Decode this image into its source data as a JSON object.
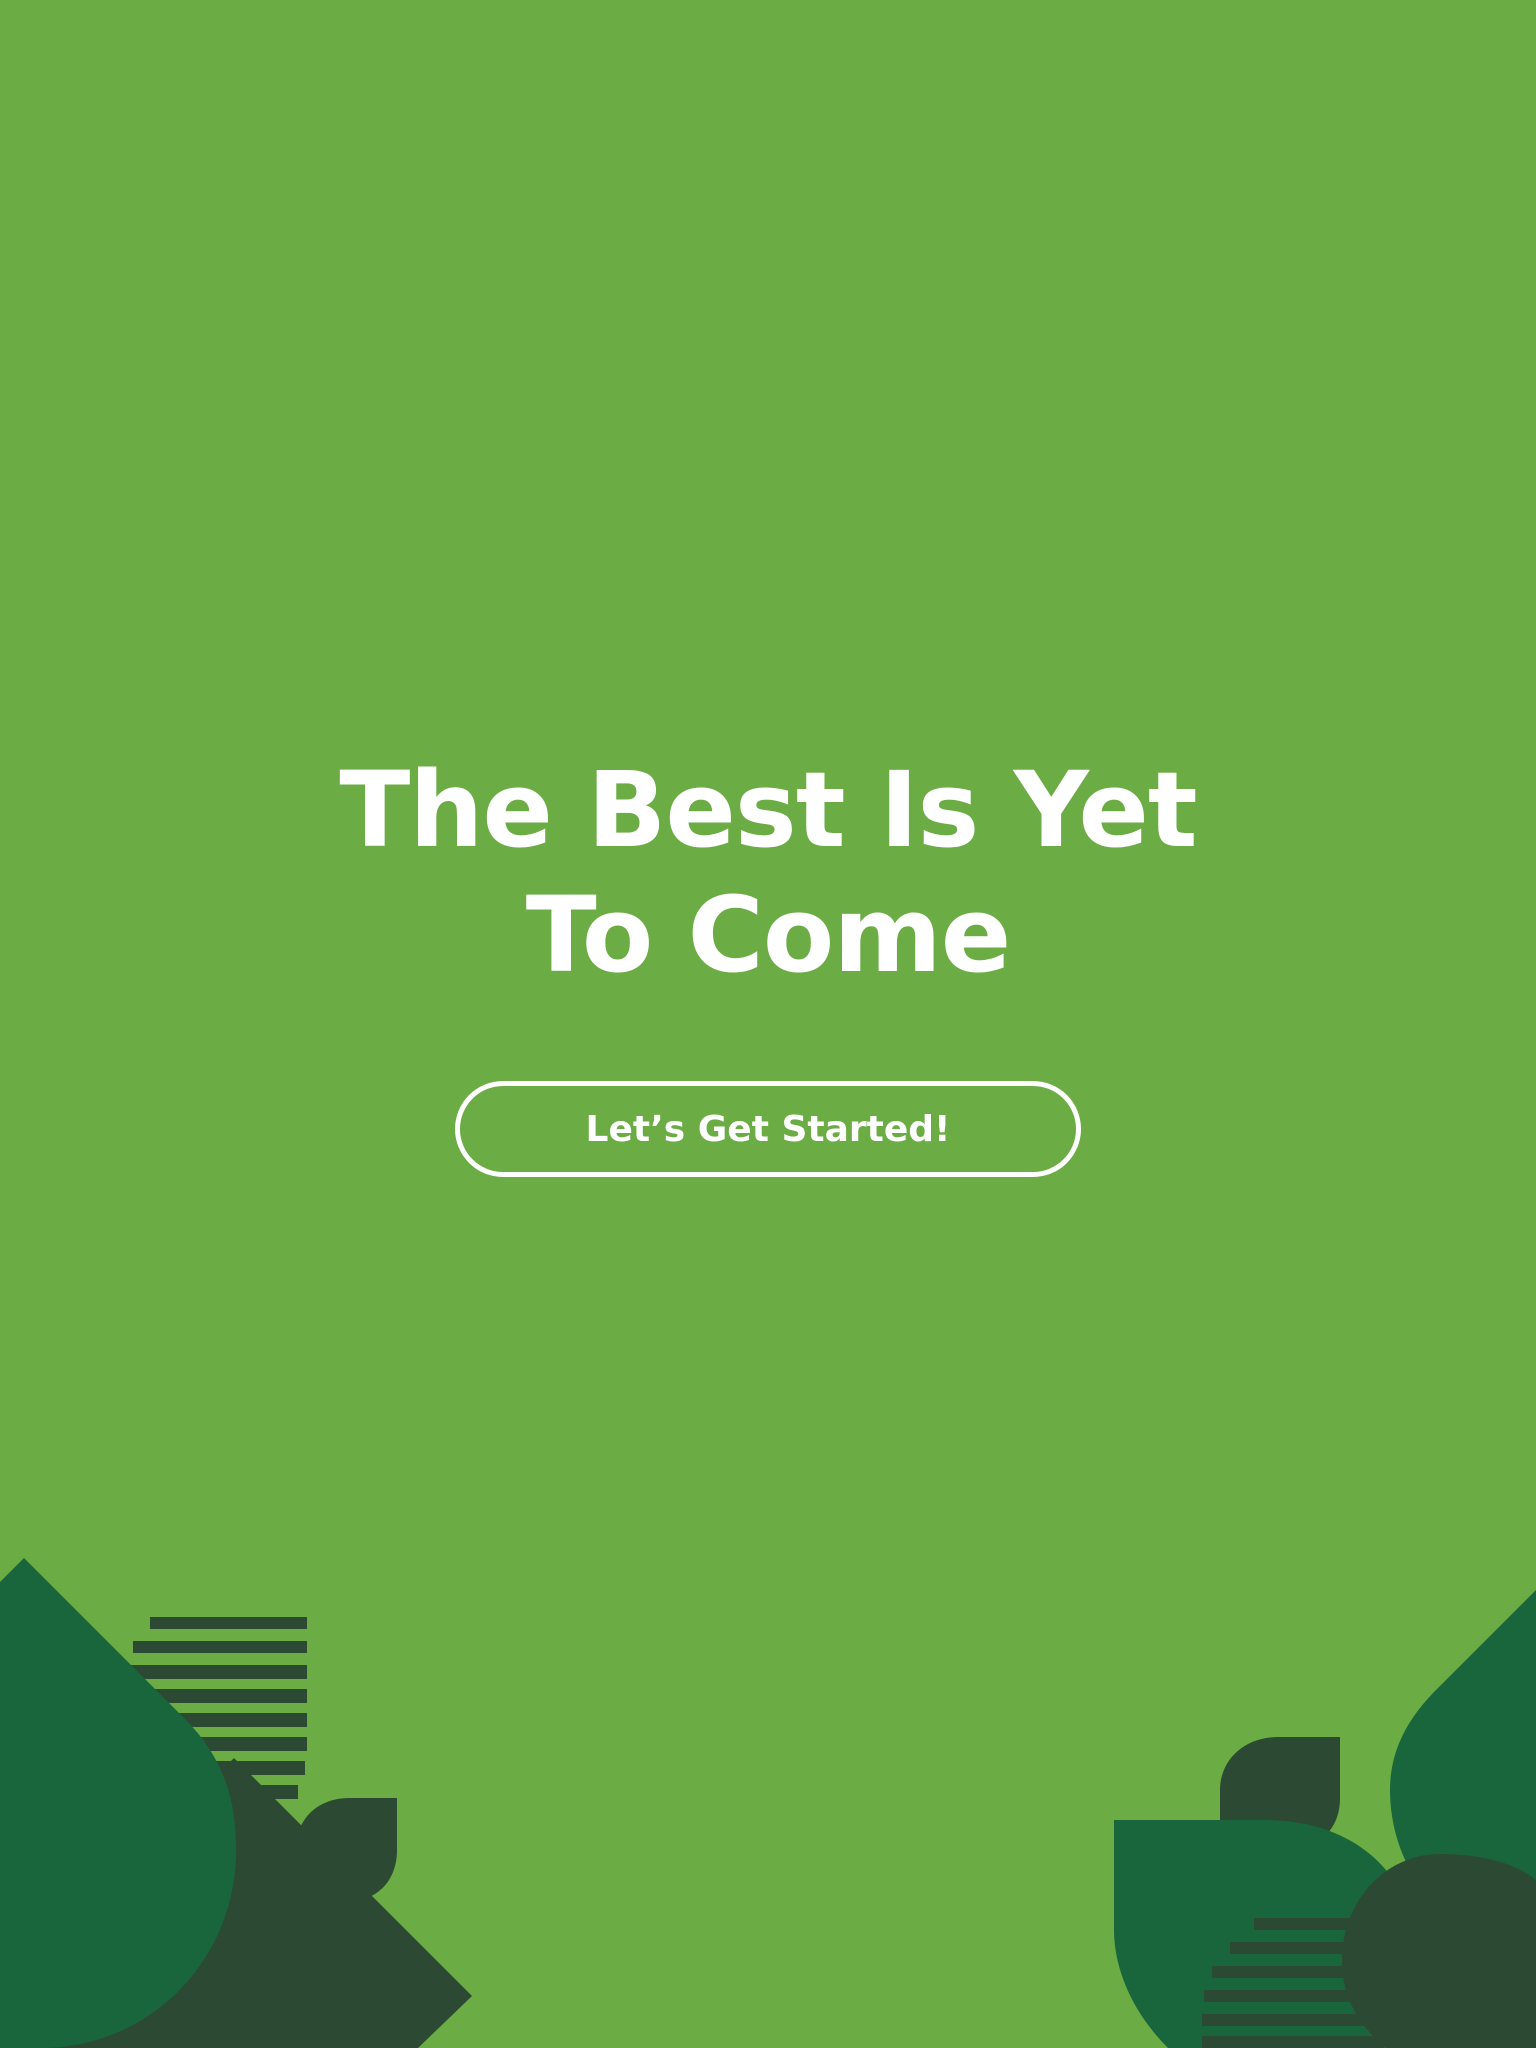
{
  "hero": {
    "title_line1": "The Best Is Yet",
    "title_line2": "To Come"
  },
  "cta": {
    "label": "Let’s Get Started!"
  },
  "colors": {
    "background": "#6bad44",
    "text": "#ffffff",
    "leaf_dark": "#2c4a33",
    "leaf_mid": "#1a663c"
  }
}
